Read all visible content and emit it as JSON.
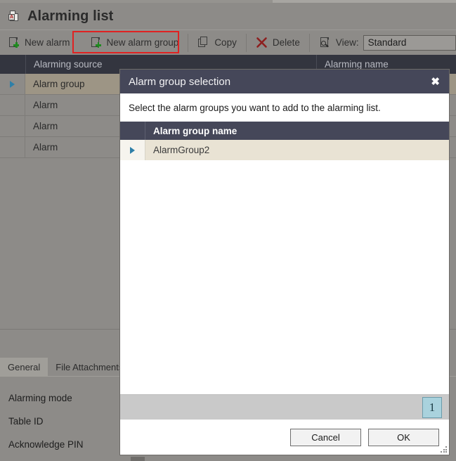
{
  "window": {
    "title": "Alarming list",
    "title_icon": "alarm-document-icon"
  },
  "toolbar": {
    "new_alarm": "New alarm",
    "new_alarm_group": "New alarm group",
    "copy": "Copy",
    "delete": "Delete",
    "view_label": "View:",
    "view_value": "Standard",
    "highlight_color": "#e02222",
    "highlighted_item": "New alarm group"
  },
  "grid": {
    "columns": [
      "Alarming source",
      "Alarming name"
    ],
    "rows": [
      {
        "source": "Alarm group",
        "selected": true
      },
      {
        "source": "Alarm",
        "selected": false
      },
      {
        "source": "Alarm",
        "selected": false
      },
      {
        "source": "Alarm",
        "selected": false
      }
    ]
  },
  "detail": {
    "tabs": [
      {
        "label": "General",
        "active": true
      },
      {
        "label": "File Attachments",
        "active": false
      }
    ],
    "fields": [
      "Alarming mode",
      "Table ID",
      "Acknowledge PIN"
    ]
  },
  "dialog": {
    "title": "Alarm group selection",
    "close_label": "✖",
    "instruction": "Select the alarm groups you want to add to the alarming list.",
    "grid": {
      "column": "Alarm group name",
      "rows": [
        {
          "name": "AlarmGroup2",
          "selected": true
        }
      ]
    },
    "pager": {
      "current_page": "1"
    },
    "buttons": {
      "cancel": "Cancel",
      "ok": "OK"
    }
  },
  "colors": {
    "app_bg": "#8d8b88",
    "grid_header": "#33353f",
    "dialog_header": "#454759",
    "row_selected": "#9d9585",
    "dialog_row_selected": "#e9e3d4",
    "pager_indicator": "#a9d2dd",
    "arrow_blue": "#2e7fa8"
  }
}
